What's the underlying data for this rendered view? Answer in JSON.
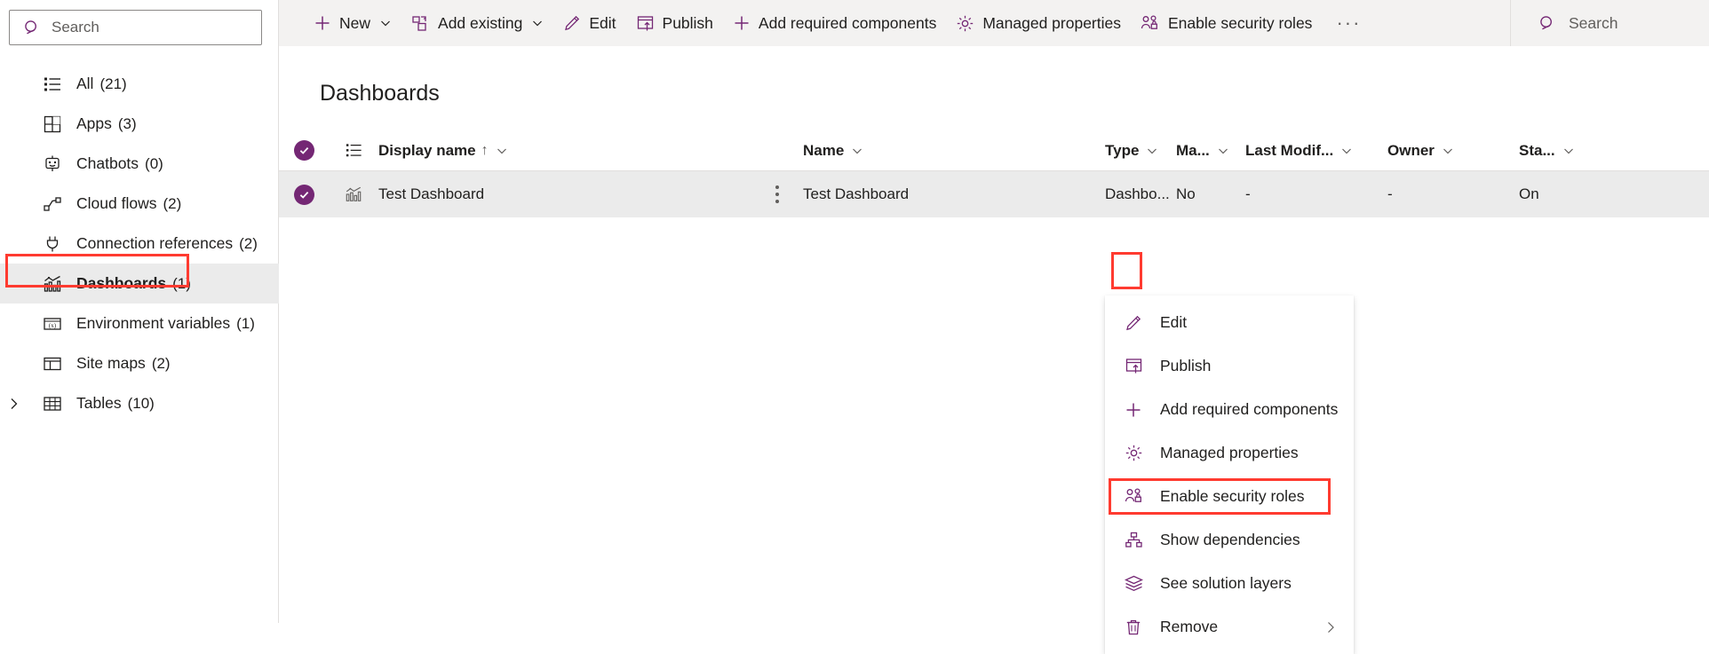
{
  "sidebar": {
    "search": {
      "placeholder": "Search",
      "icon": "search-icon"
    },
    "items": [
      {
        "label": "All",
        "count": "(21)",
        "icon": "list-icon",
        "selected": false,
        "expandable": false
      },
      {
        "label": "Apps",
        "count": "(3)",
        "icon": "apps-grid-icon",
        "selected": false,
        "expandable": false
      },
      {
        "label": "Chatbots",
        "count": "(0)",
        "icon": "chatbot-icon",
        "selected": false,
        "expandable": false
      },
      {
        "label": "Cloud flows",
        "count": "(2)",
        "icon": "cloud-flow-icon",
        "selected": false,
        "expandable": false
      },
      {
        "label": "Connection references",
        "count": "(2)",
        "icon": "plug-icon",
        "selected": false,
        "expandable": false
      },
      {
        "label": "Dashboards",
        "count": "(1)",
        "icon": "dashboard-chart-icon",
        "selected": true,
        "expandable": false
      },
      {
        "label": "Environment variables",
        "count": "(1)",
        "icon": "variable-icon",
        "selected": false,
        "expandable": false
      },
      {
        "label": "Site maps",
        "count": "(2)",
        "icon": "sitemap-layout-icon",
        "selected": false,
        "expandable": false
      },
      {
        "label": "Tables",
        "count": "(10)",
        "icon": "table-icon",
        "selected": false,
        "expandable": true
      }
    ]
  },
  "commandbar": {
    "items": [
      {
        "label": "New",
        "icon": "plus-icon",
        "chevron": true
      },
      {
        "label": "Add existing",
        "icon": "add-existing-icon",
        "chevron": true
      },
      {
        "label": "Edit",
        "icon": "pencil-icon",
        "chevron": false
      },
      {
        "label": "Publish",
        "icon": "publish-icon",
        "chevron": false
      },
      {
        "label": "Add required components",
        "icon": "plus-icon",
        "chevron": false
      },
      {
        "label": "Managed properties",
        "icon": "gear-icon",
        "chevron": false
      },
      {
        "label": "Enable security roles",
        "icon": "security-roles-icon",
        "chevron": false
      }
    ],
    "overflow_label": "···",
    "search": {
      "placeholder": "Search",
      "icon": "search-icon"
    }
  },
  "page": {
    "title": "Dashboards"
  },
  "grid": {
    "columns": [
      {
        "label": "Display name",
        "sort": "↑",
        "chevron": true
      },
      {
        "label": "Name",
        "sort": "",
        "chevron": true
      },
      {
        "label": "Type",
        "sort": "",
        "chevron": true
      },
      {
        "label": "Ma...",
        "sort": "",
        "chevron": true
      },
      {
        "label": "Last Modif...",
        "sort": "",
        "chevron": true
      },
      {
        "label": "Owner",
        "sort": "",
        "chevron": true
      },
      {
        "label": "Sta...",
        "sort": "",
        "chevron": true
      }
    ],
    "rows": [
      {
        "selected": true,
        "row_icon": "dashboard-chart-icon",
        "display_name": "Test Dashboard",
        "name": "Test Dashboard",
        "type": "Dashbo...",
        "managed": "No",
        "last_modified": "-",
        "owner": "-",
        "status": "On"
      }
    ]
  },
  "context_menu": {
    "items": [
      {
        "label": "Edit",
        "icon": "pencil-icon",
        "submenu": false,
        "highlighted": false
      },
      {
        "label": "Publish",
        "icon": "publish-icon",
        "submenu": false,
        "highlighted": false
      },
      {
        "label": "Add required components",
        "icon": "plus-icon",
        "submenu": false,
        "highlighted": false
      },
      {
        "label": "Managed properties",
        "icon": "gear-icon",
        "submenu": false,
        "highlighted": false
      },
      {
        "label": "Enable security roles",
        "icon": "security-roles-icon",
        "submenu": false,
        "highlighted": true
      },
      {
        "label": "Show dependencies",
        "icon": "dependencies-icon",
        "submenu": false,
        "highlighted": false
      },
      {
        "label": "See solution layers",
        "icon": "layers-icon",
        "submenu": false,
        "highlighted": false
      },
      {
        "label": "Remove",
        "icon": "trash-icon",
        "submenu": true,
        "highlighted": false
      }
    ]
  },
  "colors": {
    "accent": "#742774",
    "highlight": "#ff3b30",
    "command_bar_bg": "#f3f2f1",
    "row_selected_bg": "#ebebeb",
    "text": "#201f1e",
    "muted_text": "#605e5c"
  }
}
